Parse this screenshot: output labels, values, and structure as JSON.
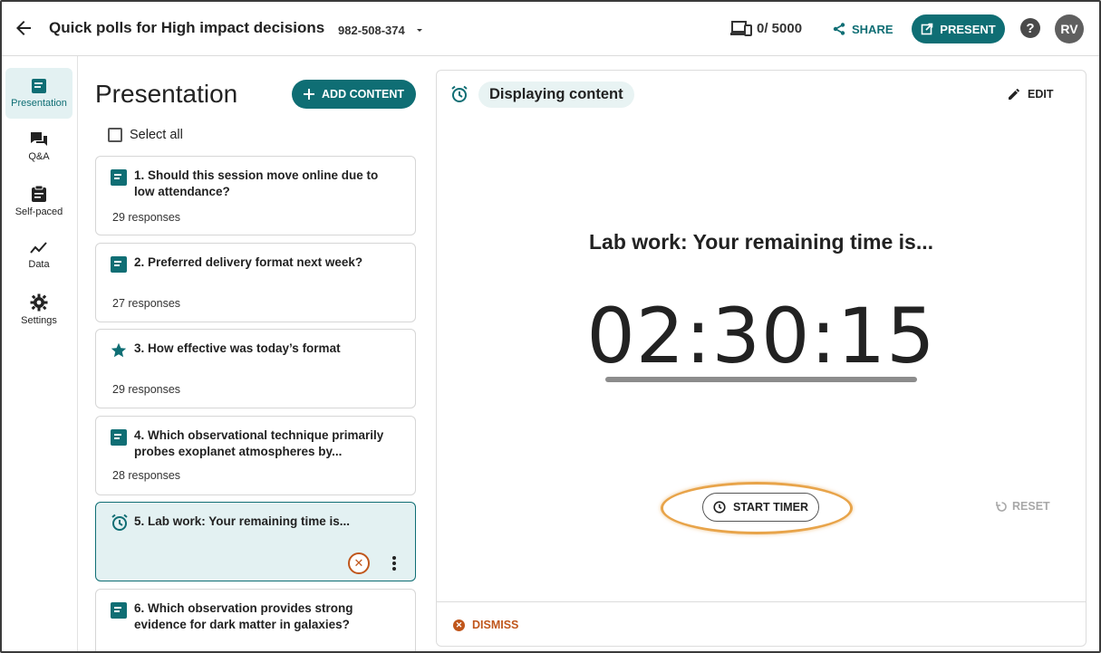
{
  "header": {
    "title": "Quick polls for High impact decisions",
    "session_code": "982-508-374",
    "participant_count": "0/ 5000",
    "share_label": "SHARE",
    "present_label": "PRESENT",
    "help_label": "?",
    "avatar_initials": "RV"
  },
  "nav": {
    "items": [
      {
        "label": "Presentation",
        "icon": "presentation-icon",
        "active": true
      },
      {
        "label": "Q&A",
        "icon": "qa-chat-icon"
      },
      {
        "label": "Self-paced",
        "icon": "clipboard-icon"
      },
      {
        "label": "Data",
        "icon": "trend-line-icon"
      },
      {
        "label": "Settings",
        "icon": "gear-icon"
      }
    ]
  },
  "list": {
    "title": "Presentation",
    "add_content_label": "ADD CONTENT",
    "select_all_label": "Select all",
    "cards": [
      {
        "title": "1. Should this session move online due to low attendance?",
        "responses": "29 responses",
        "icon": "poll-icon"
      },
      {
        "title": "2. Preferred delivery format next week?",
        "responses": "27 responses",
        "icon": "poll-icon"
      },
      {
        "title": "3. How effective was today’s format",
        "responses": "29 responses",
        "icon": "star-icon"
      },
      {
        "title": "4. Which observational technique primarily probes exoplanet atmospheres by...",
        "responses": "28 responses",
        "icon": "poll-icon"
      },
      {
        "title": "5. Lab work: Your remaining time is...",
        "responses": "",
        "icon": "alarm-icon",
        "selected": true
      },
      {
        "title": "6. Which observation provides strong evidence for dark matter in galaxies?",
        "responses": "",
        "icon": "poll-icon"
      }
    ]
  },
  "main": {
    "status_label": "Displaying content",
    "edit_label": "EDIT",
    "timer_heading": "Lab work: Your remaining time is...",
    "timer_value": "02:30:15",
    "start_timer_label": "START TIMER",
    "reset_label": "RESET",
    "dismiss_label": "DISMISS"
  },
  "colors": {
    "brand": "#0f6e74",
    "selected_bg": "#e3f1f2",
    "danger": "#c0561b",
    "highlight": "#e8a44a"
  }
}
